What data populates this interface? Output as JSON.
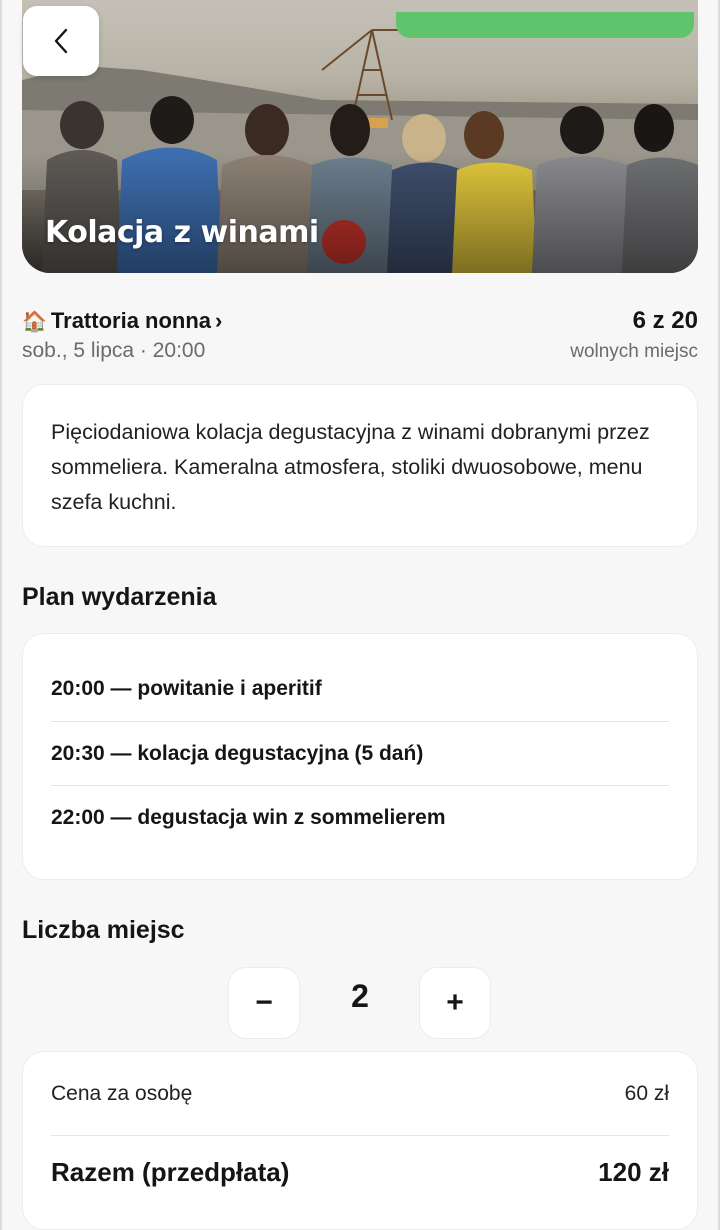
{
  "event": {
    "title": "Kolacja z winami",
    "venue_icon": "🏠",
    "venue": "Trattoria nonna",
    "venue_chevron": "›",
    "datetime": "sob., 5 lipca · 20:00",
    "seats_available": "6 z 20",
    "seats_label": "wolnych miejsc",
    "description": "Pięciodaniowa kolacja degustacyjna z winami dobranymi przez sommeliera. Kameralna atmosfera, stoliki dwuosobowe, menu szefa kuchni."
  },
  "plan": {
    "title": "Plan wydarzenia",
    "items": [
      "20:00 — powitanie i aperitif",
      "20:30 — kolacja degustacyjna (5 dań)",
      "22:00 — degustacja win z sommelierem"
    ]
  },
  "seats": {
    "title": "Liczba miejsc",
    "minus": "−",
    "plus": "+",
    "quantity": "2"
  },
  "price": {
    "unit_label": "Cena za osobę",
    "unit_value": "60 zł",
    "total_label": "Razem (przedpłata)",
    "total_value": "120 zł"
  },
  "icons": {
    "back": "chevron-left-icon",
    "venue": "house-icon"
  },
  "colors": {
    "badge": "#5fc46c",
    "background": "#f7f7f7",
    "text": "#151515",
    "muted": "#6b6b6b"
  }
}
